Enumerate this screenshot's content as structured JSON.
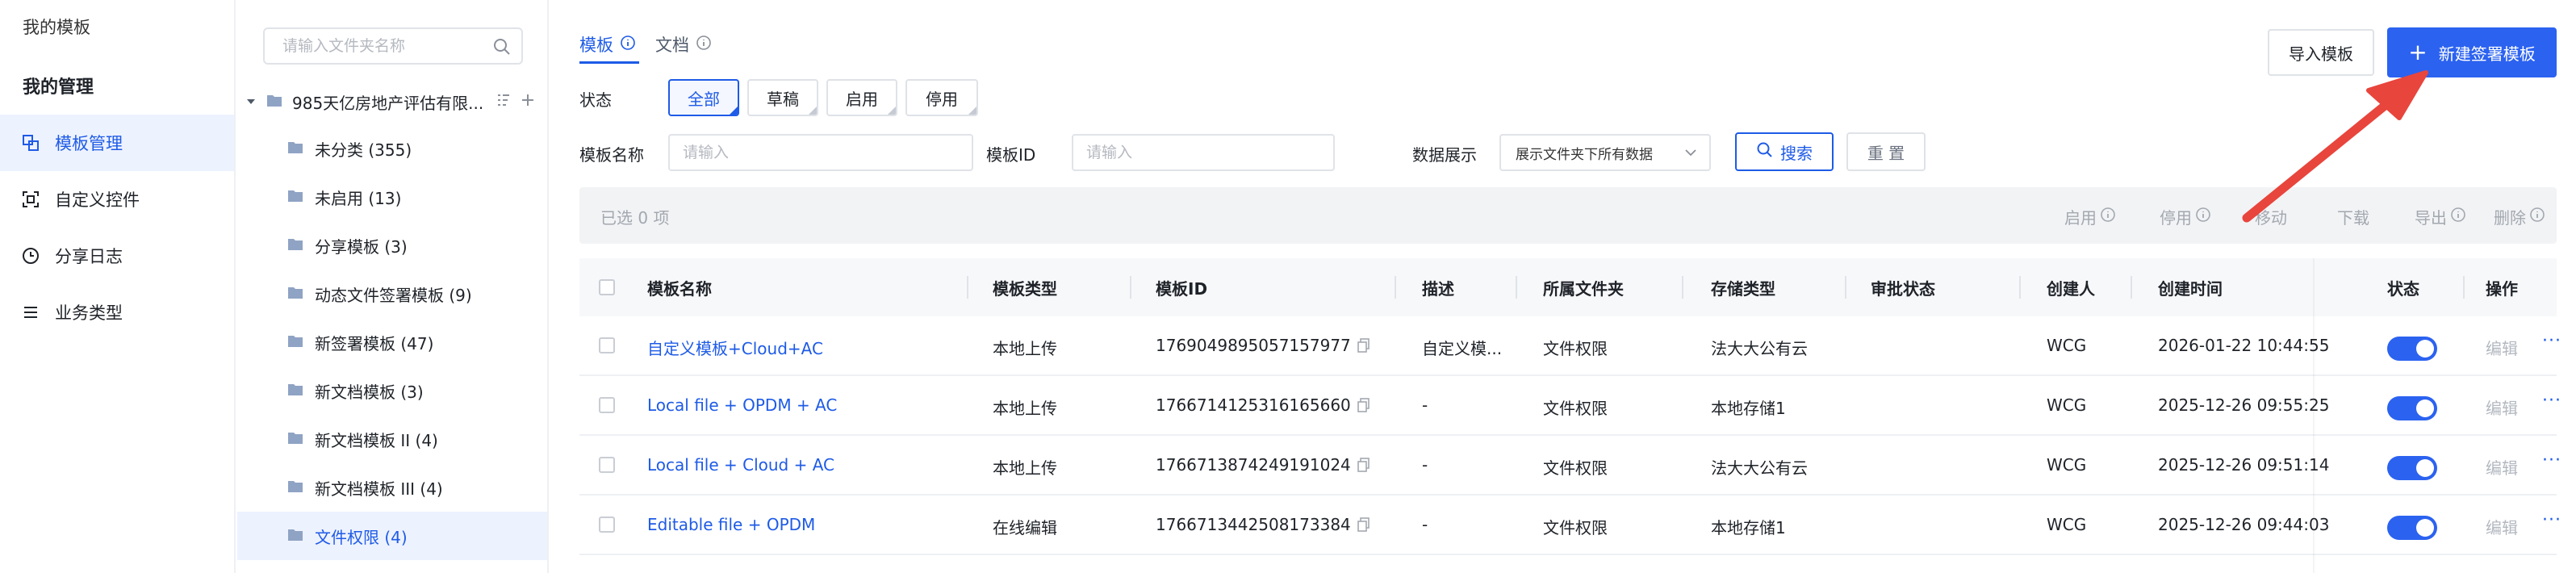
{
  "left_menu": {
    "my_templates": "我的模板",
    "my_manage": "我的管理",
    "items": [
      {
        "label": "模板管理",
        "icon": "template-manage-icon"
      },
      {
        "label": "自定义控件",
        "icon": "custom-control-icon"
      },
      {
        "label": "分享日志",
        "icon": "clock-icon"
      },
      {
        "label": "业务类型",
        "icon": "list-icon"
      }
    ],
    "active_index": 0
  },
  "folder_panel": {
    "search_placeholder": "请输入文件夹名称",
    "root": "985天亿房地产评估有限...",
    "folders": [
      "未分类 (355)",
      "未启用 (13)",
      "分享模板 (3)",
      "动态文件签署模板 (9)",
      "新签署模板 (47)",
      "新文档模板 (3)",
      "新文档模板 II (4)",
      "新文档模板 III (4)",
      "文件权限 (4)"
    ],
    "active_index": 8
  },
  "tabs": [
    "模板",
    "文档"
  ],
  "active_tab": 0,
  "filters": {
    "status_label": "状态",
    "status_options": [
      "全部",
      "草稿",
      "启用",
      "停用"
    ],
    "active_status": 0,
    "name_label": "模板名称",
    "name_placeholder": "请输入",
    "id_label": "模板ID",
    "id_placeholder": "请输入",
    "display_label": "数据展示",
    "display_value": "展示文件夹下所有数据",
    "search_button": "搜索",
    "reset_button": "重 置"
  },
  "header_buttons": {
    "import": "导入模板",
    "new": "新建签署模板"
  },
  "toolbar": {
    "selected": "已选  0  项",
    "actions": [
      "启用",
      "停用",
      "移动",
      "下载",
      "导出",
      "删除"
    ]
  },
  "table": {
    "columns": [
      "模板名称",
      "模板类型",
      "模板ID",
      "描述",
      "所属文件夹",
      "存储类型",
      "审批状态",
      "创建人",
      "创建时间",
      "状态",
      "操作"
    ],
    "rows": [
      {
        "name": "自定义模板+Cloud+AC",
        "type": "本地上传",
        "id": "1769049895057157977",
        "desc": "自定义模...",
        "folder": "文件权限",
        "storage": "法大大公有云",
        "approval": "",
        "creator": "WCG",
        "created": "2026-01-22 10:44:55",
        "enabled": true,
        "edit": "编辑",
        "more": "···"
      },
      {
        "name": "Local file + OPDM + AC",
        "type": "本地上传",
        "id": "1766714125316165660",
        "desc": "-",
        "folder": "文件权限",
        "storage": "本地存储1",
        "approval": "",
        "creator": "WCG",
        "created": "2025-12-26 09:55:25",
        "enabled": true,
        "edit": "编辑",
        "more": "···"
      },
      {
        "name": "Local file + Cloud + AC",
        "type": "本地上传",
        "id": "1766713874249191024",
        "desc": "-",
        "folder": "文件权限",
        "storage": "法大大公有云",
        "approval": "",
        "creator": "WCG",
        "created": "2025-12-26 09:51:14",
        "enabled": true,
        "edit": "编辑",
        "more": "···"
      },
      {
        "name": "Editable file + OPDM",
        "type": "在线编辑",
        "id": "1766713442508173384",
        "desc": "-",
        "folder": "文件权限",
        "storage": "本地存储1",
        "approval": "",
        "creator": "WCG",
        "created": "2025-12-26 09:44:03",
        "enabled": true,
        "edit": "编辑",
        "more": "···"
      }
    ]
  },
  "colors": {
    "accent": "#2b62f0",
    "link": "#1e5be6",
    "annotation_arrow": "#e8453c"
  }
}
